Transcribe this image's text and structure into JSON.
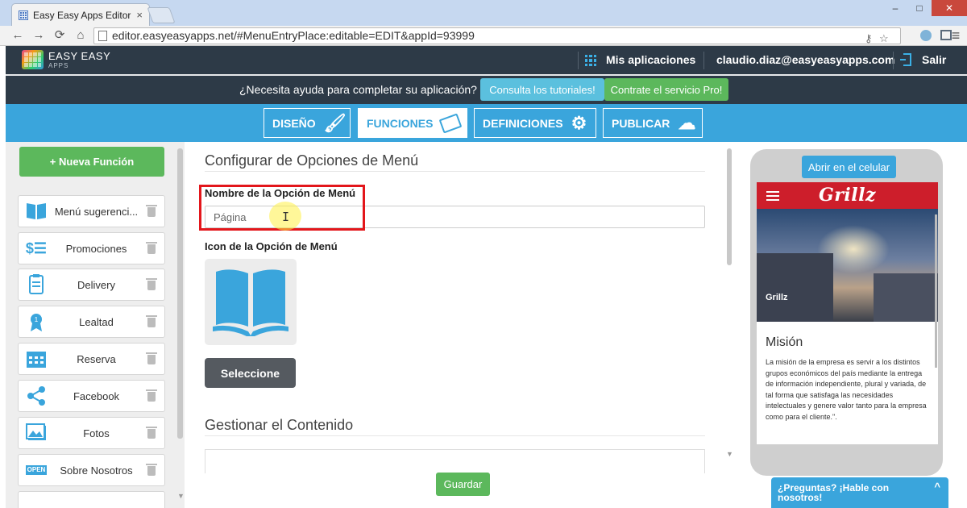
{
  "browser": {
    "tab_title": "Easy Easy Apps Editor",
    "tab_close": "×",
    "url": "editor.easyeasyapps.net/#MenuEntryPlace:editable=EDIT&appId=93999",
    "nav": {
      "back": "←",
      "forward": "→",
      "reload": "⟳",
      "home": "⌂"
    },
    "window_controls": {
      "minimize": "–",
      "maximize": "□",
      "close": "✕"
    },
    "menu_icon": "≡"
  },
  "header": {
    "logo_text": "EASY EASY",
    "logo_sub": "APPS",
    "my_apps": "Mis aplicaciones",
    "user_email": "claudio.diaz@easyeasyapps.com",
    "logout": "Salir"
  },
  "help_bar": {
    "question": "¿Necesita ayuda para completar su aplicación?",
    "tutorials_button": "Consulta los tutoriales!",
    "pro_button": "Contrate el servicio Pro!"
  },
  "nav_tabs": [
    {
      "label": "DISEÑO",
      "icon": "paintbrush-icon",
      "active": false
    },
    {
      "label": "FUNCIONES",
      "icon": "tags-icon",
      "active": true
    },
    {
      "label": "DEFINICIONES",
      "icon": "gear-icon",
      "active": false
    },
    {
      "label": "PUBLICAR",
      "icon": "cloud-upload-icon",
      "active": false
    }
  ],
  "sidebar": {
    "new_button": "+ Nueva Función",
    "items": [
      {
        "label": "Menú sugerenci...",
        "icon": "book-icon"
      },
      {
        "label": "Promociones",
        "icon": "price-tag-icon"
      },
      {
        "label": "Delivery",
        "icon": "clipboard-icon"
      },
      {
        "label": "Lealtad",
        "icon": "medal-icon"
      },
      {
        "label": "Reserva",
        "icon": "calendar-icon"
      },
      {
        "label": "Facebook",
        "icon": "share-icon"
      },
      {
        "label": "Fotos",
        "icon": "photos-icon"
      },
      {
        "label": "Sobre Nosotros",
        "icon": "open-sign-icon"
      }
    ],
    "open_sign": "OPEN"
  },
  "main": {
    "section_title": "Configurar de Opciones de Menú",
    "name_label": "Nombre de la Opción de Menú",
    "name_value": "Página",
    "icon_label": "Icon de la Opción de Menú",
    "select_button": "Seleccione",
    "content_title": "Gestionar el Contenido",
    "save_button": "Guardar"
  },
  "phone_preview": {
    "open_mobile_button": "Abrir en el celular",
    "app_title": "Grillz",
    "hero_caption": "Grillz",
    "mision_title": "Misión",
    "mision_text": "La misión de la empresa es servir a los distintos grupos económicos del país mediante la entrega de información independiente, plural y variada, de tal forma que satisfaga las necesidades intelectuales y genere valor tanto para la empresa como para el cliente.\"."
  },
  "chat": {
    "label": "¿Preguntas? ¡Hable con nosotros!",
    "chevron": "^"
  },
  "colors": {
    "header_bg": "#2d3a47",
    "accent_blue": "#3aa5dc",
    "success_green": "#5cb85c",
    "highlight_red": "#e3161b",
    "app_red": "#cd1e2b"
  }
}
